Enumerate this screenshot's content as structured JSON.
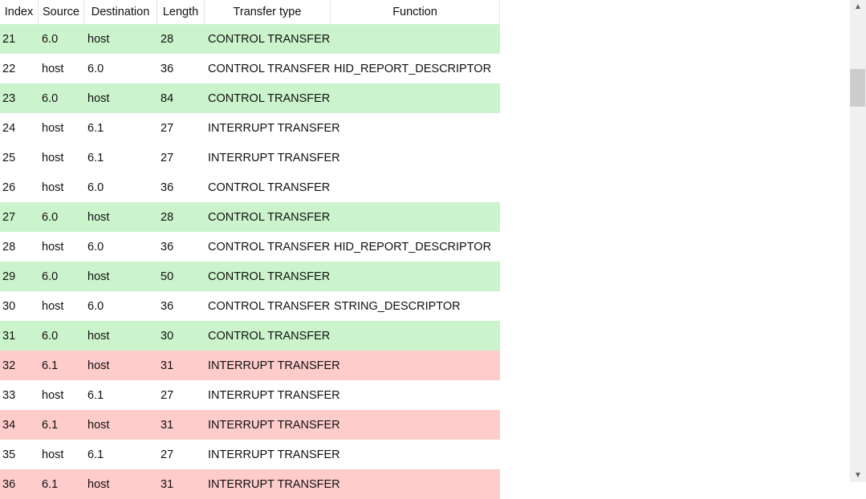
{
  "columns": [
    "Index",
    "Source",
    "Destination",
    "Length",
    "Transfer type",
    "Function"
  ],
  "colors": {
    "green": "#ccf4cc",
    "red": "#ffcccc",
    "white": "#ffffff"
  },
  "rows": [
    {
      "cells": [
        "21",
        "6.0",
        "host",
        "28",
        "CONTROL TRANSFER",
        ""
      ],
      "color": "green"
    },
    {
      "cells": [
        "22",
        "host",
        "6.0",
        "36",
        "CONTROL TRANSFER",
        "HID_REPORT_DESCRIPTOR"
      ],
      "color": "white"
    },
    {
      "cells": [
        "23",
        "6.0",
        "host",
        "84",
        "CONTROL TRANSFER",
        ""
      ],
      "color": "green"
    },
    {
      "cells": [
        "24",
        "host",
        "6.1",
        "27",
        "INTERRUPT TRANSFER",
        ""
      ],
      "color": "white"
    },
    {
      "cells": [
        "25",
        "host",
        "6.1",
        "27",
        "INTERRUPT TRANSFER",
        ""
      ],
      "color": "white"
    },
    {
      "cells": [
        "26",
        "host",
        "6.0",
        "36",
        "CONTROL TRANSFER",
        ""
      ],
      "color": "white"
    },
    {
      "cells": [
        "27",
        "6.0",
        "host",
        "28",
        "CONTROL TRANSFER",
        ""
      ],
      "color": "green"
    },
    {
      "cells": [
        "28",
        "host",
        "6.0",
        "36",
        "CONTROL TRANSFER",
        "HID_REPORT_DESCRIPTOR"
      ],
      "color": "white"
    },
    {
      "cells": [
        "29",
        "6.0",
        "host",
        "50",
        "CONTROL TRANSFER",
        ""
      ],
      "color": "green"
    },
    {
      "cells": [
        "30",
        "host",
        "6.0",
        "36",
        "CONTROL TRANSFER",
        "STRING_DESCRIPTOR"
      ],
      "color": "white"
    },
    {
      "cells": [
        "31",
        "6.0",
        "host",
        "30",
        "CONTROL TRANSFER",
        ""
      ],
      "color": "green"
    },
    {
      "cells": [
        "32",
        "6.1",
        "host",
        "31",
        "INTERRUPT TRANSFER",
        ""
      ],
      "color": "red"
    },
    {
      "cells": [
        "33",
        "host",
        "6.1",
        "27",
        "INTERRUPT TRANSFER",
        ""
      ],
      "color": "white"
    },
    {
      "cells": [
        "34",
        "6.1",
        "host",
        "31",
        "INTERRUPT TRANSFER",
        ""
      ],
      "color": "red"
    },
    {
      "cells": [
        "35",
        "host",
        "6.1",
        "27",
        "INTERRUPT TRANSFER",
        ""
      ],
      "color": "white"
    },
    {
      "cells": [
        "36",
        "6.1",
        "host",
        "31",
        "INTERRUPT TRANSFER",
        ""
      ],
      "color": "red"
    }
  ],
  "scrollbar": {
    "up_icon": "chevron-up-icon",
    "down_icon": "chevron-down-icon"
  }
}
